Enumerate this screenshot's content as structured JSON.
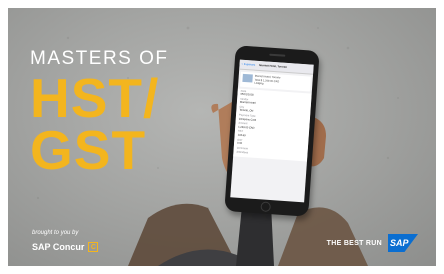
{
  "headline": {
    "line1": "MASTERS OF",
    "line2": "HST/",
    "line3": "GST"
  },
  "footer": {
    "brought_by": "brought to you by",
    "concur_name": "SAP Concur",
    "concur_icon": "C",
    "tagline": "THE BEST RUN",
    "sap_logo_text": "SAP"
  },
  "phone_screen": {
    "nav_back": "< Expenses",
    "nav_title": "Marriott Hotel, Toronto",
    "card_line1": "Marriott Hotel, Toronto",
    "card_line2": "Total $ 1,249.00 CAD",
    "card_line3": "Lodging",
    "fields": [
      {
        "label": "Date",
        "value": "05/01/2018"
      },
      {
        "label": "Vendor",
        "value": "Marriott Hotel"
      },
      {
        "label": "City",
        "value": "Toronto, ON"
      },
      {
        "label": "Payment Type",
        "value": "Company Card"
      },
      {
        "label": "Amount",
        "value": "1,249.00 CAD"
      },
      {
        "label": "HST",
        "value": "143.69"
      },
      {
        "label": "GST",
        "value": "0.00"
      },
      {
        "label": "Comment",
        "value": ""
      },
      {
        "label": "Attendees",
        "value": ""
      }
    ]
  },
  "colors": {
    "accent": "#f3b51e",
    "sap_blue": "#0a6ed1",
    "background": "#a4a5a3"
  },
  "icons": [
    "concur-logo-icon",
    "sap-logo-icon"
  ]
}
